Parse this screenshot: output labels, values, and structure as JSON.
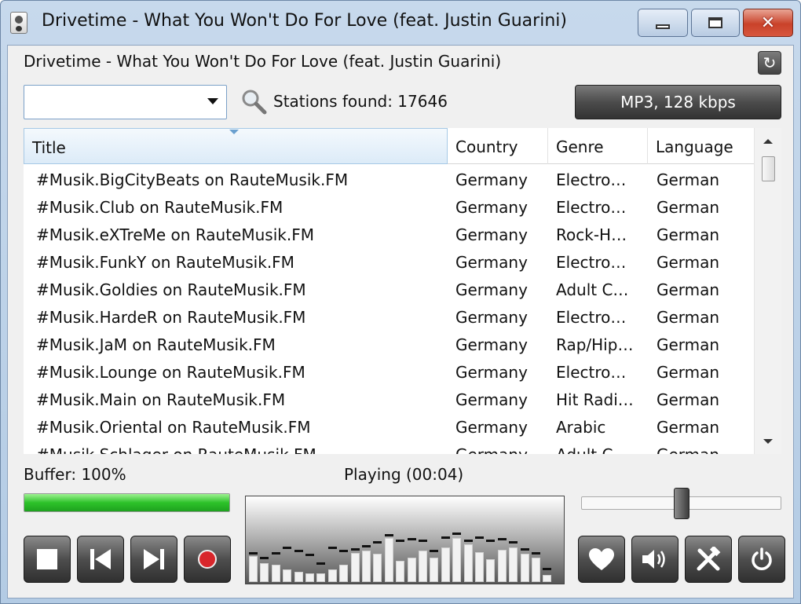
{
  "window": {
    "title": "Drivetime - What You Won't Do For Love (feat. Justin Guarini)"
  },
  "now_playing": "Drivetime - What You Won't Do For Love (feat. Justin Guarini)",
  "search": {
    "value": "",
    "stations_found_label": "Stations found: 17646"
  },
  "format_button": "MP3, 128 kbps",
  "list": {
    "columns": {
      "title": "Title",
      "country": "Country",
      "genre": "Genre",
      "language": "Language"
    },
    "rows": [
      {
        "title": "#Musik.BigCityBeats on RauteMusik.FM",
        "country": "Germany",
        "genre": "Electro…",
        "language": "German"
      },
      {
        "title": "#Musik.Club on RauteMusik.FM",
        "country": "Germany",
        "genre": "Electro…",
        "language": "German"
      },
      {
        "title": "#Musik.eXTreMe on RauteMusik.FM",
        "country": "Germany",
        "genre": "Rock-H…",
        "language": "German"
      },
      {
        "title": "#Musik.FunkY on RauteMusik.FM",
        "country": "Germany",
        "genre": "Electro…",
        "language": "German"
      },
      {
        "title": "#Musik.Goldies on RauteMusik.FM",
        "country": "Germany",
        "genre": "Adult C…",
        "language": "German"
      },
      {
        "title": "#Musik.HardeR on RauteMusik.FM",
        "country": "Germany",
        "genre": "Electro…",
        "language": "German"
      },
      {
        "title": "#Musik.JaM on RauteMusik.FM",
        "country": "Germany",
        "genre": "Rap/Hip…",
        "language": "German"
      },
      {
        "title": "#Musik.Lounge on RauteMusik.FM",
        "country": "Germany",
        "genre": "Electro…",
        "language": "German"
      },
      {
        "title": "#Musik.Main on RauteMusik.FM",
        "country": "Germany",
        "genre": "Hit Radi…",
        "language": "German"
      },
      {
        "title": "#Musik.Oriental on RauteMusik.FM",
        "country": "Germany",
        "genre": "Arabic",
        "language": "German"
      },
      {
        "title": "#Musik.Schlager on RauteMusik.FM",
        "country": "Germany",
        "genre": "Adult C…",
        "language": "German"
      }
    ]
  },
  "status": {
    "buffer_label": "Buffer: 100%",
    "buffer_percent": 100,
    "playing_label": "Playing (00:04)"
  },
  "volume": {
    "level": 0.5
  },
  "visualizer": {
    "levels": [
      0.3,
      0.22,
      0.2,
      0.14,
      0.12,
      0.1,
      0.1,
      0.14,
      0.2,
      0.33,
      0.36,
      0.32,
      0.5,
      0.24,
      0.28,
      0.36,
      0.28,
      0.4,
      0.5,
      0.43,
      0.34,
      0.26,
      0.37,
      0.4,
      0.32,
      0.28,
      0.08
    ],
    "peaks": [
      0.3,
      0.24,
      0.3,
      0.36,
      0.32,
      0.28,
      0.18,
      0.36,
      0.32,
      0.34,
      0.38,
      0.42,
      0.5,
      0.44,
      0.46,
      0.44,
      0.32,
      0.48,
      0.52,
      0.44,
      0.48,
      0.44,
      0.46,
      0.42,
      0.34,
      0.3,
      0.12
    ]
  },
  "controls": {
    "stop": "stop-icon",
    "previous": "previous-icon",
    "next": "next-icon",
    "record": "record-icon",
    "favorite": "heart-icon",
    "volume": "speaker-icon",
    "settings": "tools-icon",
    "power": "power-icon"
  }
}
